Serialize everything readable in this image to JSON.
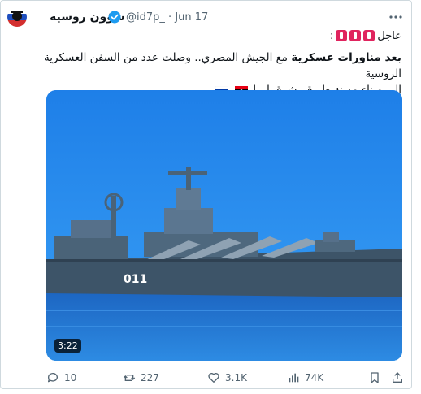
{
  "tweet": {
    "display_name": "شؤون روسية",
    "handle": "@id7p_",
    "separator": "·",
    "date": "Jun 17",
    "urgent_label": "عاجل",
    "urgent_colon": ":",
    "line1_bold": "بعد مناورات عسكرية",
    "line1_rest": " مع الجيش المصري.. وصلت عدد من السفن العسكرية الروسية",
    "line2": "إلى ميناء مدينة طبرق، شرق ليبيا",
    "video_duration": "3:22",
    "ship_hull_number": "011"
  },
  "actions": {
    "replies": "10",
    "reposts": "227",
    "likes": "3.1K",
    "views": "74K"
  },
  "icons": {
    "avatar": "avatar-icon",
    "verified": "verified-badge-icon",
    "more": "more-icon",
    "reply": "reply-icon",
    "repost": "repost-icon",
    "like": "like-icon",
    "views": "views-icon",
    "bookmark": "bookmark-icon",
    "share": "share-icon"
  },
  "colors": {
    "accent": "#1d9bf0",
    "muted": "#536471",
    "urgent_red": "#e0245e"
  }
}
